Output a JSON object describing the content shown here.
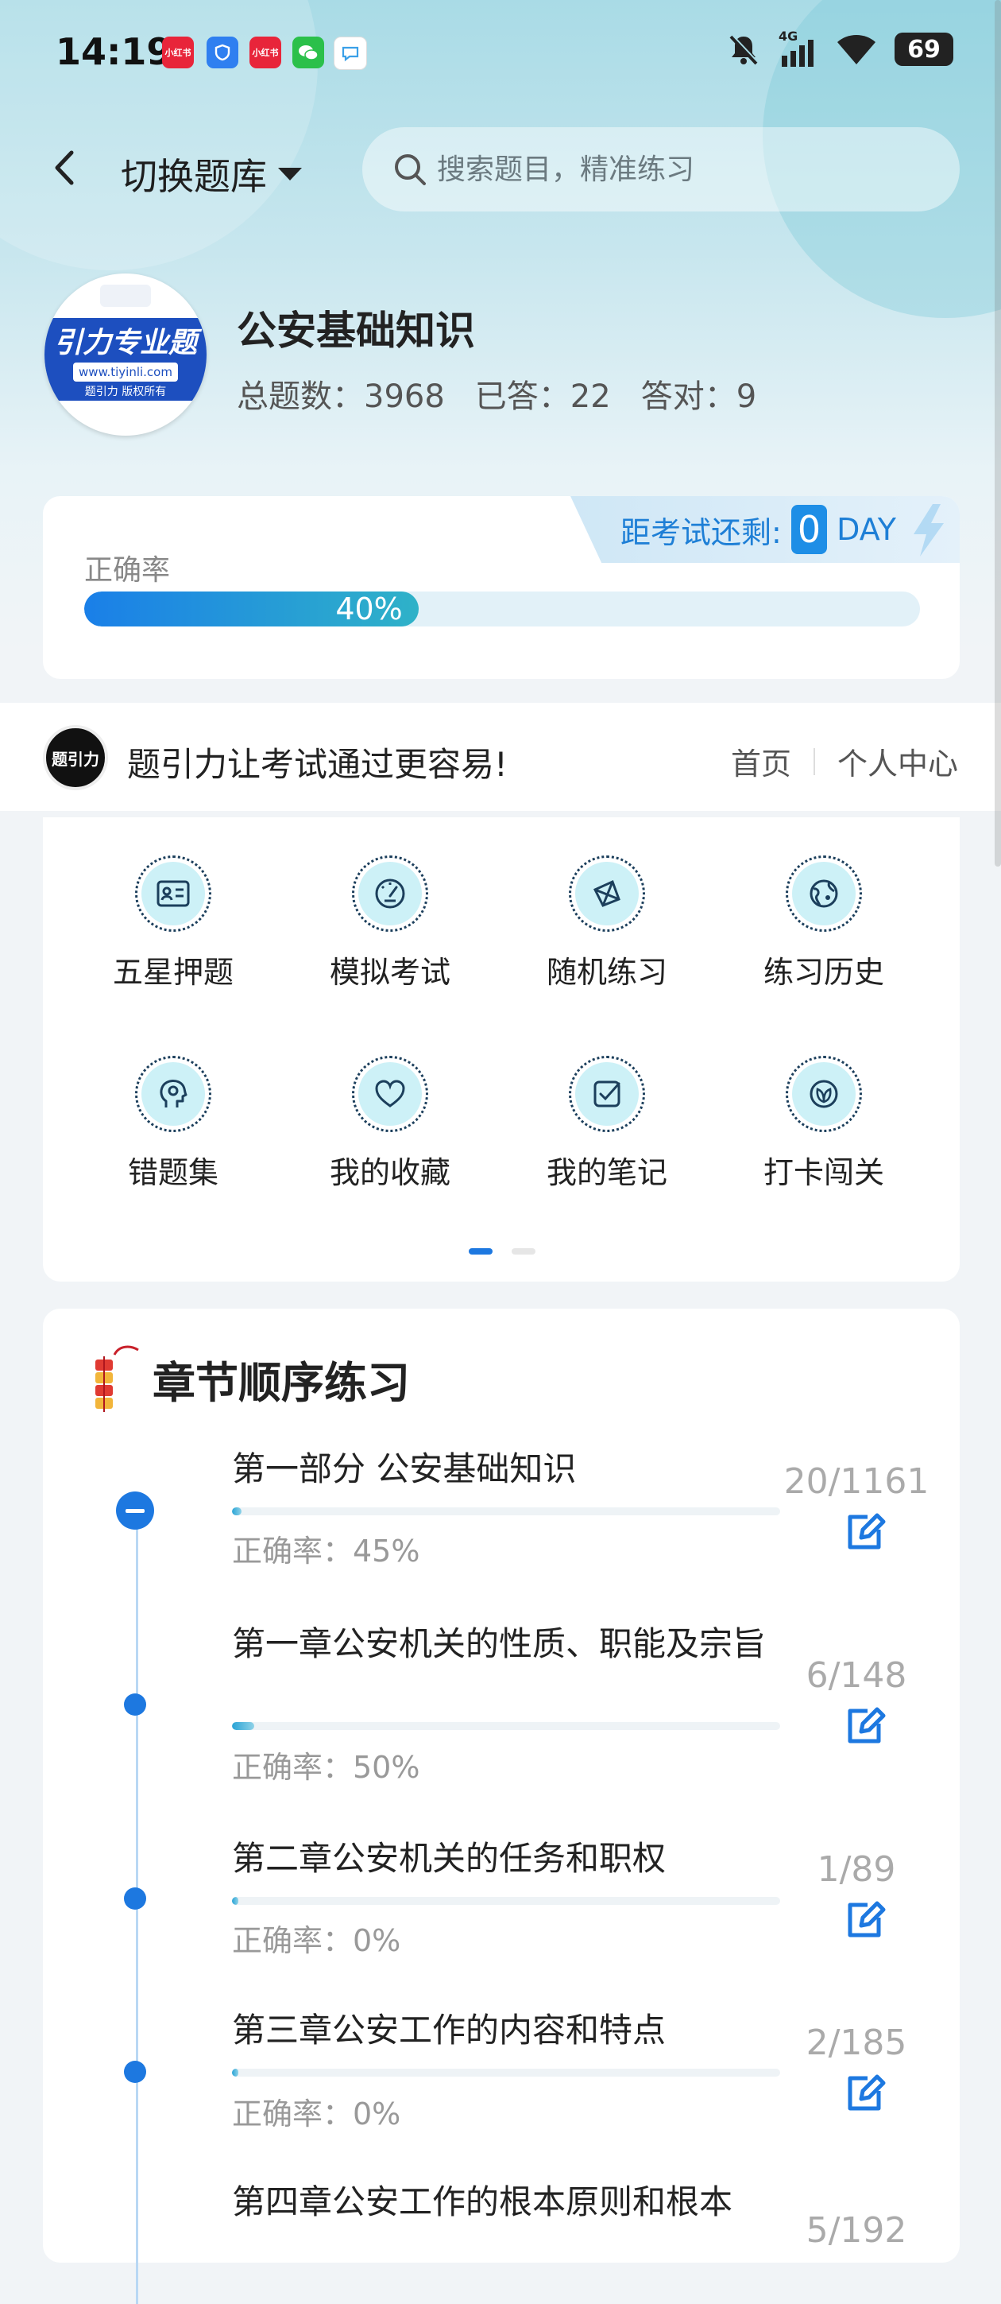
{
  "status_bar": {
    "time": "14:19",
    "apps": [
      {
        "name": "xiaohongshu-icon",
        "label": "小红书",
        "color": "#e8253a"
      },
      {
        "name": "shield-app-icon",
        "label": "",
        "color": "#2f7ff0"
      },
      {
        "name": "xiaohongshu-icon-2",
        "label": "小红书",
        "color": "#e8253a"
      },
      {
        "name": "wechat-icon",
        "label": "",
        "color": "#2bc04a"
      },
      {
        "name": "chat-bubble-icon",
        "label": "",
        "color": "#ffffff"
      }
    ],
    "network": "4G",
    "battery": "69"
  },
  "header": {
    "switch_label": "切换题库",
    "search_placeholder": "搜索题目，精准练习"
  },
  "bank": {
    "logo_text": "引力专业题",
    "logo_url": "www.tiyinli.com",
    "logo_sub": "题引力 版权所有",
    "title": "公安基础知识",
    "total": "总题数：3968",
    "answered": "已答：22",
    "correct": "答对：9"
  },
  "accuracy": {
    "countdown_label": "距考试还剩:",
    "days": "0",
    "day_unit": "DAY",
    "label": "正确率",
    "percent_text": "40%",
    "percent": 40
  },
  "promo": {
    "logo_text": "题引力",
    "slogan": "题引力让考试通过更容易!",
    "link_home": "首页",
    "link_profile": "个人中心"
  },
  "grid": {
    "items": [
      {
        "label": "五星押题",
        "icon": "id-card-icon"
      },
      {
        "label": "模拟考试",
        "icon": "speedometer-icon"
      },
      {
        "label": "随机练习",
        "icon": "network-icon"
      },
      {
        "label": "练习历史",
        "icon": "globe-icon"
      },
      {
        "label": "错题集",
        "icon": "head-icon"
      },
      {
        "label": "我的收藏",
        "icon": "heart-icon"
      },
      {
        "label": "我的笔记",
        "icon": "check-note-icon"
      },
      {
        "label": "打卡闯关",
        "icon": "leaf-badge-icon"
      }
    ],
    "page": 1,
    "pages": 2
  },
  "chapters": {
    "title": "章节顺序练习",
    "items": [
      {
        "name": "第一部分 公安基础知识",
        "accuracy": "正确率：45%",
        "count": "20/1161",
        "progress": 0.017
      },
      {
        "name": "第一章公安机关的性质、职能及宗旨",
        "accuracy": "正确率：50%",
        "count": "6/148",
        "progress": 0.04
      },
      {
        "name": "第二章公安机关的任务和职权",
        "accuracy": "正确率：0%",
        "count": "1/89",
        "progress": 0.011
      },
      {
        "name": "第三章公安工作的内容和特点",
        "accuracy": "正确率：0%",
        "count": "2/185",
        "progress": 0.011
      },
      {
        "name": "第四章公安工作的根本原则和根本",
        "accuracy": "",
        "count": "5/192",
        "progress": 0.0
      }
    ]
  }
}
